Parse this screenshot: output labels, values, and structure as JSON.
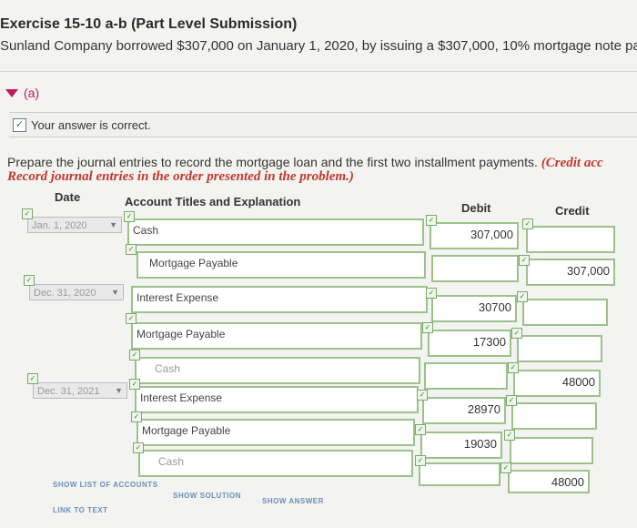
{
  "header": {
    "title": "Exercise 15-10 a-b (Part Level Submission)",
    "description": "Sunland Company borrowed $307,000 on January 1, 2020, by issuing a $307,000, 10% mortgage note pa"
  },
  "part": {
    "label": "(a)"
  },
  "feedback": {
    "text": "Your answer is correct."
  },
  "instructions": {
    "line1": "Prepare the journal entries to record the mortgage loan and the first two installment payments.",
    "line1_red": "(Credit acc",
    "line2": "Record journal entries in the order presented in the problem.)"
  },
  "table": {
    "headers": {
      "date": "Date",
      "account": "Account Titles and Explanation",
      "debit": "Debit",
      "credit": "Credit"
    },
    "entries": [
      {
        "date": "Jan. 1, 2020",
        "rows": [
          {
            "account": "Cash",
            "debit": "307,000",
            "credit": ""
          },
          {
            "account": "Mortgage Payable",
            "debit": "",
            "credit": "307,000"
          }
        ]
      },
      {
        "date": "Dec. 31, 2020",
        "rows": [
          {
            "account": "Interest Expense",
            "debit": "30700",
            "credit": ""
          },
          {
            "account": "Mortgage Payable",
            "debit": "17300",
            "credit": ""
          },
          {
            "account": "Cash",
            "debit": "",
            "credit": "48000"
          }
        ]
      },
      {
        "date": "Dec. 31, 2021",
        "rows": [
          {
            "account": "Interest Expense",
            "debit": "28970",
            "credit": ""
          },
          {
            "account": "Mortgage Payable",
            "debit": "19030",
            "credit": ""
          },
          {
            "account": "Cash",
            "debit": "",
            "credit": "48000"
          }
        ]
      }
    ]
  },
  "links": {
    "show_accounts": "SHOW LIST OF ACCOUNTS",
    "show_solution": "SHOW SOLUTION",
    "show_answer": "SHOW ANSWER",
    "link_to_text": "LINK TO TEXT"
  }
}
